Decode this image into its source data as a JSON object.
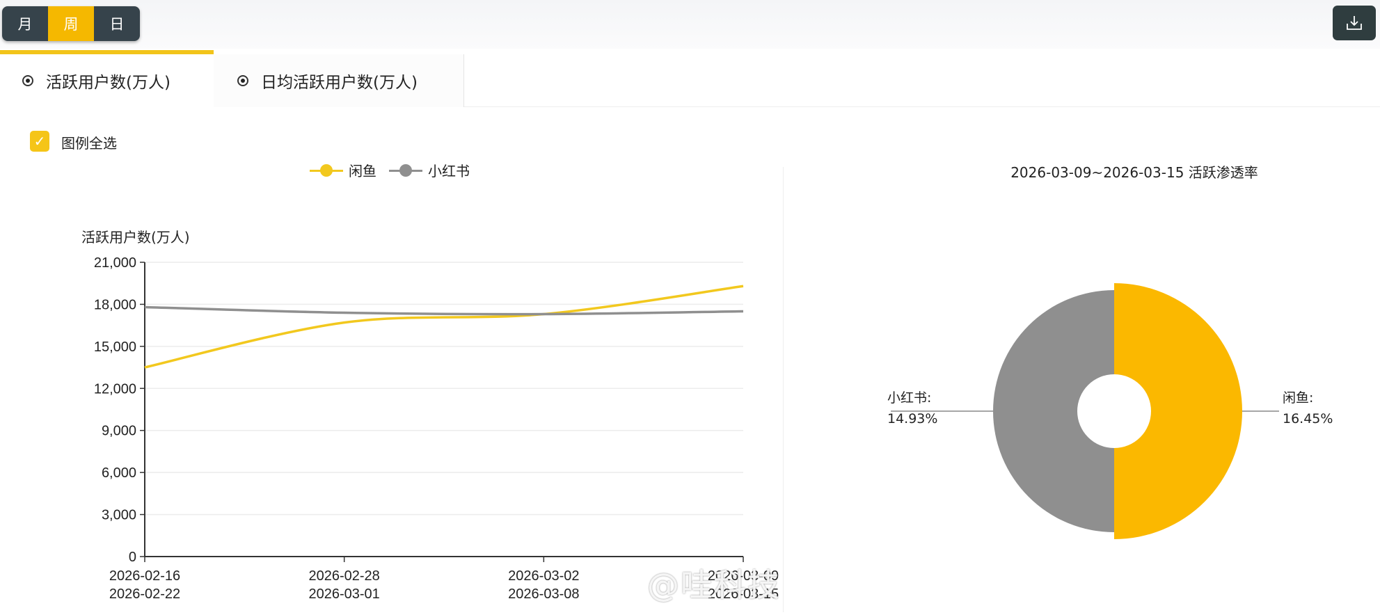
{
  "toolbar": {
    "periods": [
      "月",
      "周",
      "日"
    ],
    "active_period": "周",
    "download_icon": "download-icon"
  },
  "tabs": [
    {
      "label": "活跃用户数(万人)",
      "active": true
    },
    {
      "label": "日均活跃用户数(万人)",
      "active": false
    }
  ],
  "legend_select_all": {
    "label": "图例全选",
    "checked": true
  },
  "colors": {
    "accent": "#f5b800",
    "xianyu": "#f2c81e",
    "xiaohongshu": "#8f8f8f",
    "dark": "#36434b"
  },
  "watermark": "@哇科技",
  "chart_data": [
    {
      "type": "line",
      "title": "",
      "ylabel": "活跃用户数(万人)",
      "xlabel": "",
      "ylim": [
        0,
        21000
      ],
      "yticks": [
        "21,000",
        "18,000",
        "15,000",
        "12,000",
        "9,000",
        "6,000",
        "3,000",
        "0"
      ],
      "ytick_values": [
        21000,
        18000,
        15000,
        12000,
        9000,
        6000,
        3000,
        0
      ],
      "categories": [
        [
          "2026-02-16",
          "2026-02-22"
        ],
        [
          "2026-02-28",
          "2026-03-01"
        ],
        [
          "2026-03-02",
          "2026-03-08"
        ],
        [
          "2026-03-09",
          "2026-03-15"
        ]
      ],
      "grid": true,
      "legend_position": "top",
      "series": [
        {
          "name": "闲鱼",
          "values": [
            13500,
            16700,
            17300,
            19300
          ]
        },
        {
          "name": "小红书",
          "values": [
            17800,
            17400,
            17300,
            17500
          ]
        }
      ]
    },
    {
      "type": "pie",
      "title": "2026-03-09~2026-03-15 活跃渗透率",
      "slices": [
        {
          "name": "闲鱼",
          "label": "闲鱼:",
          "value": 16.45,
          "display": "16.45%"
        },
        {
          "name": "小红书",
          "label": "小红书:",
          "value": 14.93,
          "display": "14.93%"
        }
      ]
    }
  ]
}
